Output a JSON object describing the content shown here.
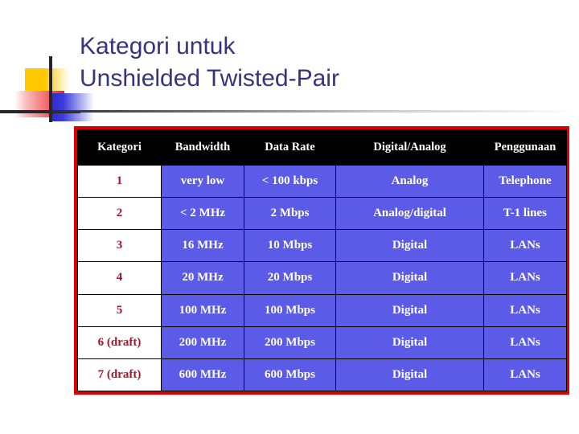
{
  "slide": {
    "title": "Kategori untuk\nUnshielded Twisted-Pair",
    "title_color": "#35357E",
    "accent_border_color": "#DD0000",
    "header_bg_color": "#000000",
    "cell_bg_color": "#5B5BE8",
    "key_text_color": "#A5152B"
  },
  "decor": {
    "yellow_swatch": "#FFC800",
    "red_swatch": "#EE2222",
    "blue_swatch": "#3A3ADD",
    "rule_color": "#25252E"
  },
  "table": {
    "columns": [
      "Kategori",
      "Bandwidth",
      "Data Rate",
      "Digital/Analog",
      "Penggunaan"
    ],
    "rows": [
      {
        "kategori": "1",
        "bandwidth": "very low",
        "data_rate": "< 100 kbps",
        "digital_analog": "Analog",
        "penggunaan": "Telephone"
      },
      {
        "kategori": "2",
        "bandwidth": "< 2 MHz",
        "data_rate": "2 Mbps",
        "digital_analog": "Analog/digital",
        "penggunaan": "T-1 lines"
      },
      {
        "kategori": "3",
        "bandwidth": "16 MHz",
        "data_rate": "10 Mbps",
        "digital_analog": "Digital",
        "penggunaan": "LANs"
      },
      {
        "kategori": "4",
        "bandwidth": "20 MHz",
        "data_rate": "20 Mbps",
        "digital_analog": "Digital",
        "penggunaan": "LANs"
      },
      {
        "kategori": "5",
        "bandwidth": "100 MHz",
        "data_rate": "100 Mbps",
        "digital_analog": "Digital",
        "penggunaan": "LANs"
      },
      {
        "kategori": "6 (draft)",
        "bandwidth": "200 MHz",
        "data_rate": "200 Mbps",
        "digital_analog": "Digital",
        "penggunaan": "LANs"
      },
      {
        "kategori": "7 (draft)",
        "bandwidth": "600 MHz",
        "data_rate": "600 Mbps",
        "digital_analog": "Digital",
        "penggunaan": "LANs"
      }
    ]
  }
}
